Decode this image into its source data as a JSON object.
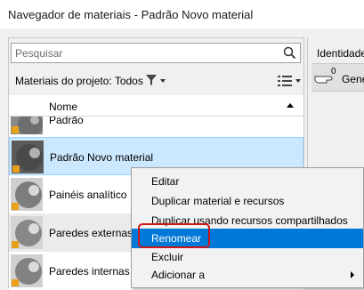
{
  "window": {
    "title": "Navegador de materiais - Padrão Novo material"
  },
  "search": {
    "placeholder": "Pesquisar"
  },
  "toolbar": {
    "label": "Materiais do projeto: Todos"
  },
  "list": {
    "column_header": "Nome",
    "rows": [
      {
        "name": "Padrão"
      },
      {
        "name": "Padrão Novo material"
      },
      {
        "name": "Painéis analítico"
      },
      {
        "name": "Paredes externas"
      },
      {
        "name": "Paredes internas"
      }
    ]
  },
  "right_panel": {
    "tab": "Identidade",
    "count": "0",
    "name": "Gene"
  },
  "context_menu": {
    "items": [
      "Editar",
      "Duplicar material e recursos",
      "Duplicar usando recursos compartilhados",
      "Renomear",
      "Excluir",
      "Adicionar a"
    ]
  },
  "colors": {
    "selection": "#cce8ff",
    "highlight": "#0078d7",
    "callout": "#c81818"
  }
}
